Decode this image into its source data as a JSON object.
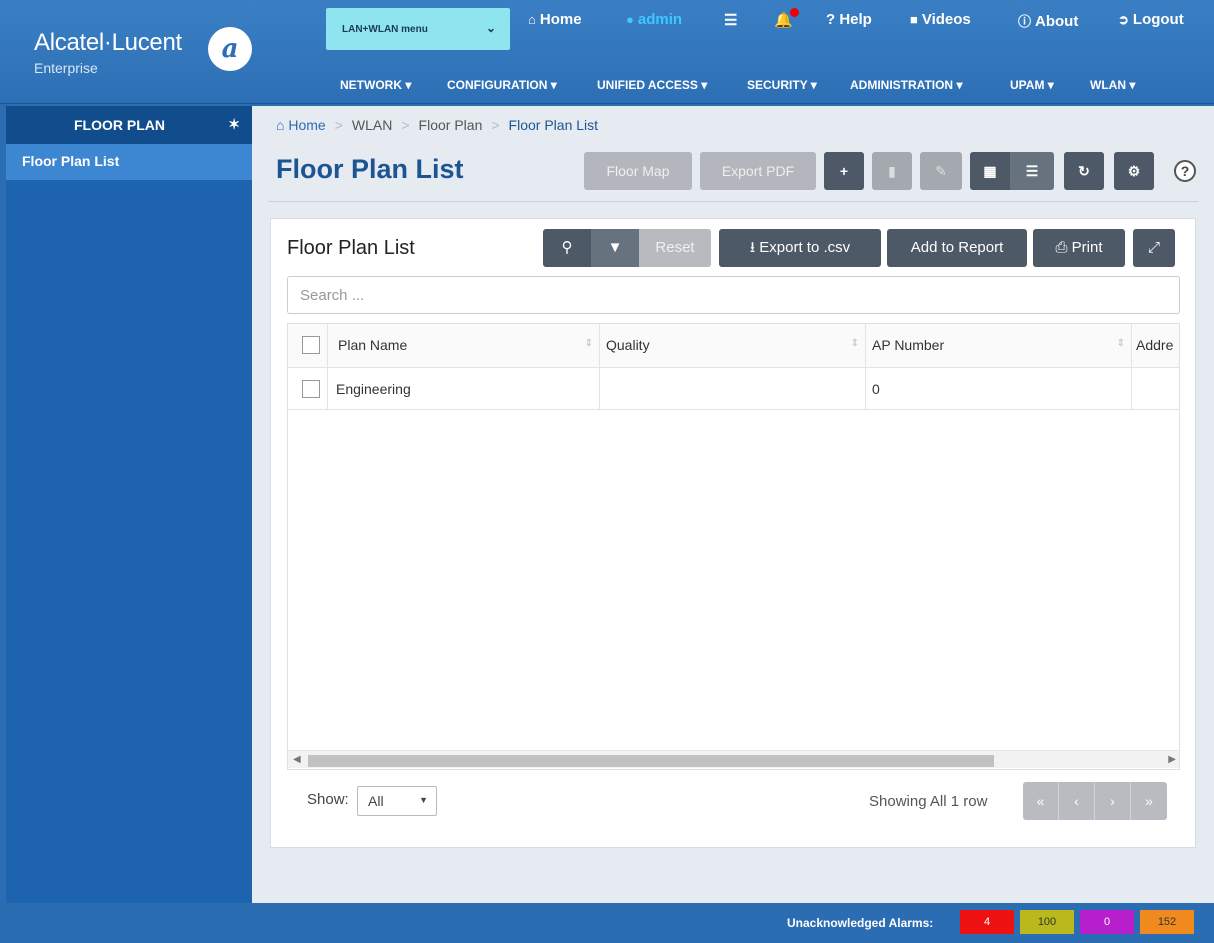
{
  "header": {
    "brand": "Alcatel·Lucent",
    "brand_sub": "Enterprise",
    "view_select": "LAN+WLAN menu",
    "top_links": {
      "home": "Home",
      "user": "admin",
      "help": "? Help",
      "videos": "Videos",
      "about": "About",
      "logout": "Logout"
    },
    "nav": [
      "NETWORK",
      "CONFIGURATION",
      "UNIFIED ACCESS",
      "SECURITY",
      "ADMINISTRATION",
      "UPAM",
      "WLAN"
    ]
  },
  "sidebar": {
    "title": "FLOOR PLAN",
    "items": [
      "Floor Plan List"
    ]
  },
  "breadcrumb": [
    "Home",
    "WLAN",
    "Floor Plan",
    "Floor Plan List"
  ],
  "page": {
    "title": "Floor Plan List",
    "buttons": {
      "floor_map": "Floor Map",
      "export_pdf": "Export PDF"
    }
  },
  "card": {
    "title": "Floor Plan List",
    "toolbar": {
      "reset": "Reset",
      "export": "Export to .csv",
      "add_report": "Add to Report",
      "print": "Print"
    },
    "search_placeholder": "Search ...",
    "columns": [
      "Plan Name",
      "Quality",
      "AP Number",
      "Addre"
    ],
    "rows": [
      {
        "plan_name": "Engineering",
        "quality": "",
        "ap_number": "0",
        "address": ""
      }
    ],
    "show_label": "Show:",
    "show_value": "All",
    "showing": "Showing All 1 row"
  },
  "statusbar": {
    "label": "Unacknowledged Alarms:",
    "alarms": [
      {
        "value": "4",
        "color": "#ee1111"
      },
      {
        "value": "100",
        "color": "#b9b81c"
      },
      {
        "value": "0",
        "color": "#b61fcb"
      },
      {
        "value": "152",
        "color": "#f08a1e"
      }
    ]
  },
  "colors": {
    "header_blue": "#2d6fb4",
    "sidebar_blue": "#1e63ad",
    "title_blue": "#1d5593",
    "admin_cyan": "#3fc7ff",
    "dark_button": "#4d5966"
  }
}
